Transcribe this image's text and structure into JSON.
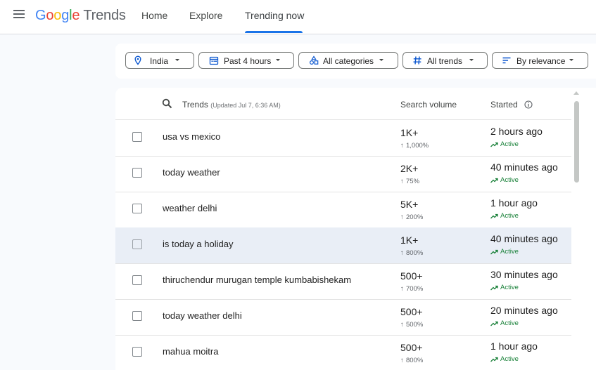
{
  "header": {
    "logo_google": [
      "G",
      "o",
      "o",
      "g",
      "l",
      "e"
    ],
    "logo_product": "Trends",
    "tabs": [
      {
        "label": "Home"
      },
      {
        "label": "Explore"
      },
      {
        "label": "Trending now",
        "active": true
      }
    ]
  },
  "filters": [
    {
      "label": "India",
      "icon": "location-pin-icon"
    },
    {
      "label": "Past 4 hours",
      "icon": "calendar-icon"
    },
    {
      "label": "All categories",
      "icon": "categories-icon"
    },
    {
      "label": "All trends",
      "icon": "hashtag-icon"
    },
    {
      "label": "By relevance",
      "icon": "sort-icon"
    }
  ],
  "table": {
    "header": {
      "trends": "Trends",
      "updated": "(Updated Jul 7, 6:36 AM)",
      "volume": "Search volume",
      "started": "Started"
    },
    "rows": [
      {
        "trend": "usa vs mexico",
        "volume": "1K+",
        "change": "1,000%",
        "started": "2 hours ago",
        "status": "Active"
      },
      {
        "trend": "today weather",
        "volume": "2K+",
        "change": "75%",
        "started": "40 minutes ago",
        "status": "Active"
      },
      {
        "trend": "weather delhi",
        "volume": "5K+",
        "change": "200%",
        "started": "1 hour ago",
        "status": "Active"
      },
      {
        "trend": "is today a holiday",
        "volume": "1K+",
        "change": "800%",
        "started": "40 minutes ago",
        "status": "Active",
        "highlighted": true
      },
      {
        "trend": "thiruchendur murugan temple kumbabishekam",
        "volume": "500+",
        "change": "700%",
        "started": "30 minutes ago",
        "status": "Active"
      },
      {
        "trend": "today weather delhi",
        "volume": "500+",
        "change": "500%",
        "started": "20 minutes ago",
        "status": "Active"
      },
      {
        "trend": "mahua moitra",
        "volume": "500+",
        "change": "800%",
        "started": "1 hour ago",
        "status": "Active"
      }
    ]
  },
  "colors": {
    "accent": "#1a73e8",
    "active_green": "#188038",
    "highlight_row": "#e9eef6"
  }
}
